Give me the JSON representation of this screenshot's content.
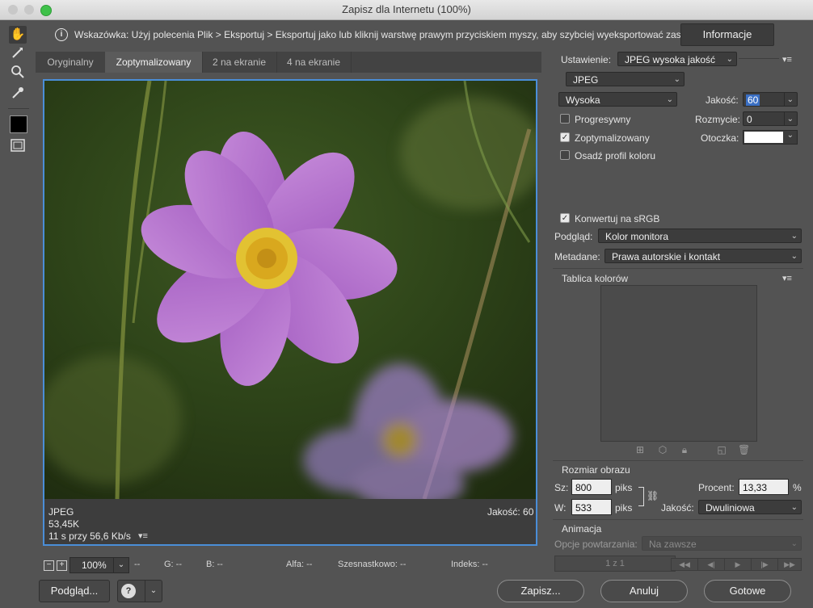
{
  "window": {
    "title": "Zapisz dla Internetu (100%)"
  },
  "hint": {
    "text": "Wskazówka: Użyj polecenia Plik > Eksportuj > Eksportuj jako lub kliknij warstwę prawym przyciskiem myszy, aby szybciej wyeksportować zasoby.",
    "info_button": "Informacje"
  },
  "tabs": [
    {
      "label": "Oryginalny"
    },
    {
      "label": "Zoptymalizowany"
    },
    {
      "label": "2 na ekranie"
    },
    {
      "label": "4 na ekranie"
    }
  ],
  "preview": {
    "format": "JPEG",
    "size": "53,45K",
    "time": "11 s przy 56,6 Kb/s",
    "quality_label": "Jakość: 60"
  },
  "statusbar": {
    "zoom": "100%",
    "dash": "--",
    "g": "G: --",
    "b": "B: --",
    "alpha": "Alfa: --",
    "hex": "Szesnastkowo: --",
    "index": "Indeks: --"
  },
  "bottom": {
    "preview_button": "Podgląd...",
    "save_button": "Zapisz...",
    "cancel_button": "Anuluj",
    "done_button": "Gotowe"
  },
  "settings": {
    "preset_label": "Ustawienie:",
    "preset_value": "JPEG wysoka jakość",
    "format_value": "JPEG",
    "compression_value": "Wysoka",
    "quality_label": "Jakość:",
    "quality_value": "60",
    "progressive": "Progresywny",
    "blur_label": "Rozmycie:",
    "blur_value": "0",
    "optimized": "Zoptymalizowany",
    "matte_label": "Otoczka:",
    "embed_profile": "Osadź profil koloru",
    "convert_srgb": "Konwertuj na sRGB",
    "preview_label": "Podgląd:",
    "preview_value": "Kolor monitora",
    "metadata_label": "Metadane:",
    "metadata_value": "Prawa autorskie i kontakt",
    "color_table": "Tablica kolorów"
  },
  "image_size": {
    "header": "Rozmiar obrazu",
    "w_label": "Sz:",
    "w_value": "800",
    "h_label": "W:",
    "h_value": "533",
    "unit": "piks",
    "percent_label": "Procent:",
    "percent_value": "13,33",
    "percent_sign": "%",
    "quality_label": "Jakość:",
    "quality_value": "Dwuliniowa"
  },
  "animation": {
    "header": "Animacja",
    "loop_label": "Opcje powtarzania:",
    "loop_value": "Na zawsze",
    "frame_counter": "1 z 1"
  },
  "colors": {
    "accent": "#4a8ed8",
    "bg": "#535353"
  }
}
